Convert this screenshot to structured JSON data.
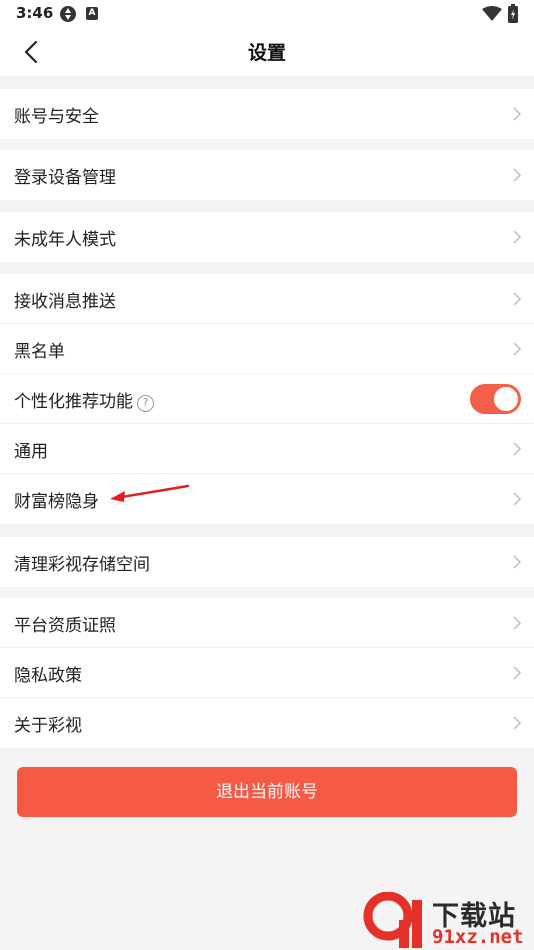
{
  "status_bar": {
    "time": "3:46",
    "a_icon_letter": "A"
  },
  "header": {
    "title": "设置"
  },
  "groups": [
    {
      "items": [
        {
          "label": "账号与安全"
        }
      ]
    },
    {
      "items": [
        {
          "label": "登录设备管理"
        }
      ]
    },
    {
      "items": [
        {
          "label": "未成年人模式"
        }
      ]
    },
    {
      "items": [
        {
          "label": "接收消息推送"
        },
        {
          "label": "黑名单"
        },
        {
          "label": "个性化推荐功能",
          "toggle_on": true
        },
        {
          "label": "通用"
        },
        {
          "label": "财富榜隐身"
        }
      ]
    },
    {
      "items": [
        {
          "label": "清理彩视存储空间"
        }
      ]
    },
    {
      "items": [
        {
          "label": "平台资质证照"
        },
        {
          "label": "隐私政策"
        },
        {
          "label": "关于彩视"
        }
      ]
    }
  ],
  "logout": {
    "label": "退出当前账号"
  },
  "watermark": {
    "line1": "下载站",
    "line2": "91xz.net"
  },
  "colors": {
    "accent": "#f45a44",
    "toggle_on": "#f2604a",
    "background": "#f4f4f4",
    "annotation_arrow": "#e02020"
  },
  "icons": {
    "back": "chevron-left-icon",
    "row_arrow": "chevron-right-icon",
    "help": "question-circle-icon"
  }
}
